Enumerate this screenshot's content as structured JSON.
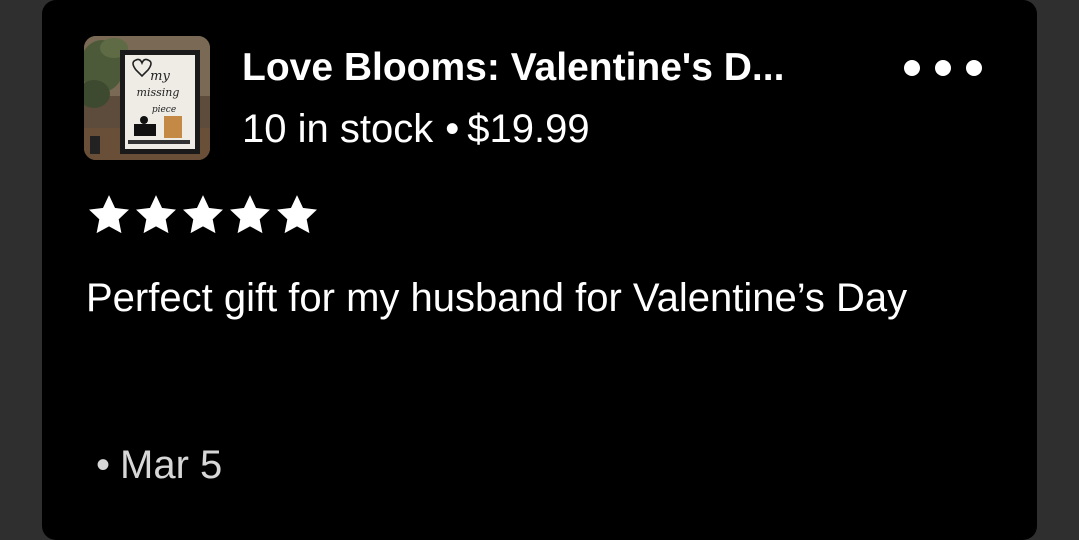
{
  "listing": {
    "title": "Love Blooms: Valentine's D...",
    "stock": "10 in stock",
    "separator": "•",
    "price": "$19.99",
    "thumbnail_icon": "product-photo-my-missing-piece-sign",
    "thumbnail_text": [
      "my",
      "missing",
      "piece"
    ]
  },
  "menu": {
    "icon": "more-horizontal-icon"
  },
  "review": {
    "rating": 5,
    "rating_max": 5,
    "star_color": "#ffffff",
    "text": "Perfect gift for my husband for Valentine’s Day",
    "date_bullet": "•",
    "date": "Mar 5"
  }
}
